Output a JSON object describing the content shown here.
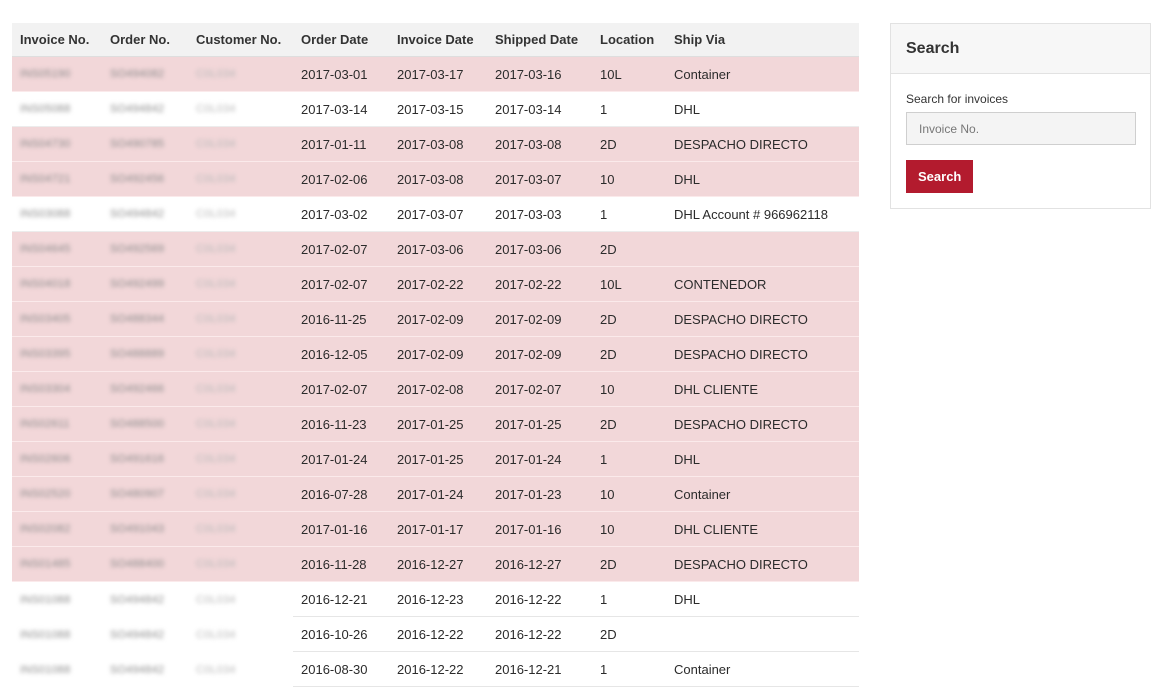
{
  "table": {
    "headers": [
      "Invoice No.",
      "Order No.",
      "Customer No.",
      "Order Date",
      "Invoice Date",
      "Shipped Date",
      "Location",
      "Ship Via"
    ],
    "rows": [
      {
        "highlight": true,
        "invoice": "INS05190",
        "order": "SO494082",
        "customer": "C0L034",
        "order_date": "2017-03-01",
        "invoice_date": "2017-03-17",
        "shipped_date": "2017-03-16",
        "location": "10L",
        "ship_via": "Container"
      },
      {
        "highlight": false,
        "invoice": "INS05088",
        "order": "SO494842",
        "customer": "C0L034",
        "order_date": "2017-03-14",
        "invoice_date": "2017-03-15",
        "shipped_date": "2017-03-14",
        "location": "1",
        "ship_via": "DHL"
      },
      {
        "highlight": true,
        "invoice": "INS04730",
        "order": "SO490785",
        "customer": "C0L034",
        "order_date": "2017-01-11",
        "invoice_date": "2017-03-08",
        "shipped_date": "2017-03-08",
        "location": "2D",
        "ship_via": "DESPACHO DIRECTO"
      },
      {
        "highlight": true,
        "invoice": "INS04721",
        "order": "SO492456",
        "customer": "C0L034",
        "order_date": "2017-02-06",
        "invoice_date": "2017-03-08",
        "shipped_date": "2017-03-07",
        "location": "10",
        "ship_via": "DHL"
      },
      {
        "highlight": false,
        "invoice": "INS03088",
        "order": "SO494842",
        "customer": "C0L034",
        "order_date": "2017-03-02",
        "invoice_date": "2017-03-07",
        "shipped_date": "2017-03-03",
        "location": "1",
        "ship_via": "DHL Account # 966962118"
      },
      {
        "highlight": true,
        "invoice": "INS04645",
        "order": "SO492569",
        "customer": "C0L034",
        "order_date": "2017-02-07",
        "invoice_date": "2017-03-06",
        "shipped_date": "2017-03-06",
        "location": "2D",
        "ship_via": ""
      },
      {
        "highlight": true,
        "invoice": "INS04018",
        "order": "SO492499",
        "customer": "C0L034",
        "order_date": "2017-02-07",
        "invoice_date": "2017-02-22",
        "shipped_date": "2017-02-22",
        "location": "10L",
        "ship_via": "CONTENEDOR"
      },
      {
        "highlight": true,
        "invoice": "INS03405",
        "order": "SO488344",
        "customer": "C0L034",
        "order_date": "2016-11-25",
        "invoice_date": "2017-02-09",
        "shipped_date": "2017-02-09",
        "location": "2D",
        "ship_via": "DESPACHO DIRECTO"
      },
      {
        "highlight": true,
        "invoice": "INS03395",
        "order": "SO488889",
        "customer": "C0L034",
        "order_date": "2016-12-05",
        "invoice_date": "2017-02-09",
        "shipped_date": "2017-02-09",
        "location": "2D",
        "ship_via": "DESPACHO DIRECTO"
      },
      {
        "highlight": true,
        "invoice": "INS03304",
        "order": "SO492466",
        "customer": "C0L034",
        "order_date": "2017-02-07",
        "invoice_date": "2017-02-08",
        "shipped_date": "2017-02-07",
        "location": "10",
        "ship_via": "DHL CLIENTE"
      },
      {
        "highlight": true,
        "invoice": "INS02611",
        "order": "SO488500",
        "customer": "C0L034",
        "order_date": "2016-11-23",
        "invoice_date": "2017-01-25",
        "shipped_date": "2017-01-25",
        "location": "2D",
        "ship_via": "DESPACHO DIRECTO"
      },
      {
        "highlight": true,
        "invoice": "INS02606",
        "order": "SO491616",
        "customer": "C0L034",
        "order_date": "2017-01-24",
        "invoice_date": "2017-01-25",
        "shipped_date": "2017-01-24",
        "location": "1",
        "ship_via": "DHL"
      },
      {
        "highlight": true,
        "invoice": "INS02520",
        "order": "SO480907",
        "customer": "C0L034",
        "order_date": "2016-07-28",
        "invoice_date": "2017-01-24",
        "shipped_date": "2017-01-23",
        "location": "10",
        "ship_via": "Container"
      },
      {
        "highlight": true,
        "invoice": "INS02082",
        "order": "SO491043",
        "customer": "C0L034",
        "order_date": "2017-01-16",
        "invoice_date": "2017-01-17",
        "shipped_date": "2017-01-16",
        "location": "10",
        "ship_via": "DHL CLIENTE"
      },
      {
        "highlight": true,
        "invoice": "INS01485",
        "order": "SO488400",
        "customer": "C0L034",
        "order_date": "2016-11-28",
        "invoice_date": "2016-12-27",
        "shipped_date": "2016-12-27",
        "location": "2D",
        "ship_via": "DESPACHO DIRECTO"
      },
      {
        "highlight": false,
        "invoice": "INS01088",
        "order": "SO494842",
        "customer": "C0L034",
        "order_date": "2016-12-21",
        "invoice_date": "2016-12-23",
        "shipped_date": "2016-12-22",
        "location": "1",
        "ship_via": "DHL"
      },
      {
        "highlight": false,
        "invoice": "INS01088",
        "order": "SO494842",
        "customer": "C0L034",
        "order_date": "2016-10-26",
        "invoice_date": "2016-12-22",
        "shipped_date": "2016-12-22",
        "location": "2D",
        "ship_via": ""
      },
      {
        "highlight": false,
        "invoice": "INS01088",
        "order": "SO494842",
        "customer": "C0L034",
        "order_date": "2016-08-30",
        "invoice_date": "2016-12-22",
        "shipped_date": "2016-12-21",
        "location": "1",
        "ship_via": "Container"
      }
    ]
  },
  "search": {
    "title": "Search",
    "label": "Search for invoices",
    "placeholder": "Invoice No.",
    "value": "",
    "button_label": "Search"
  },
  "colors": {
    "highlight_row": "#f2d7d9",
    "header_bg": "#f2f2f2",
    "button_bg": "#b31b2e"
  }
}
